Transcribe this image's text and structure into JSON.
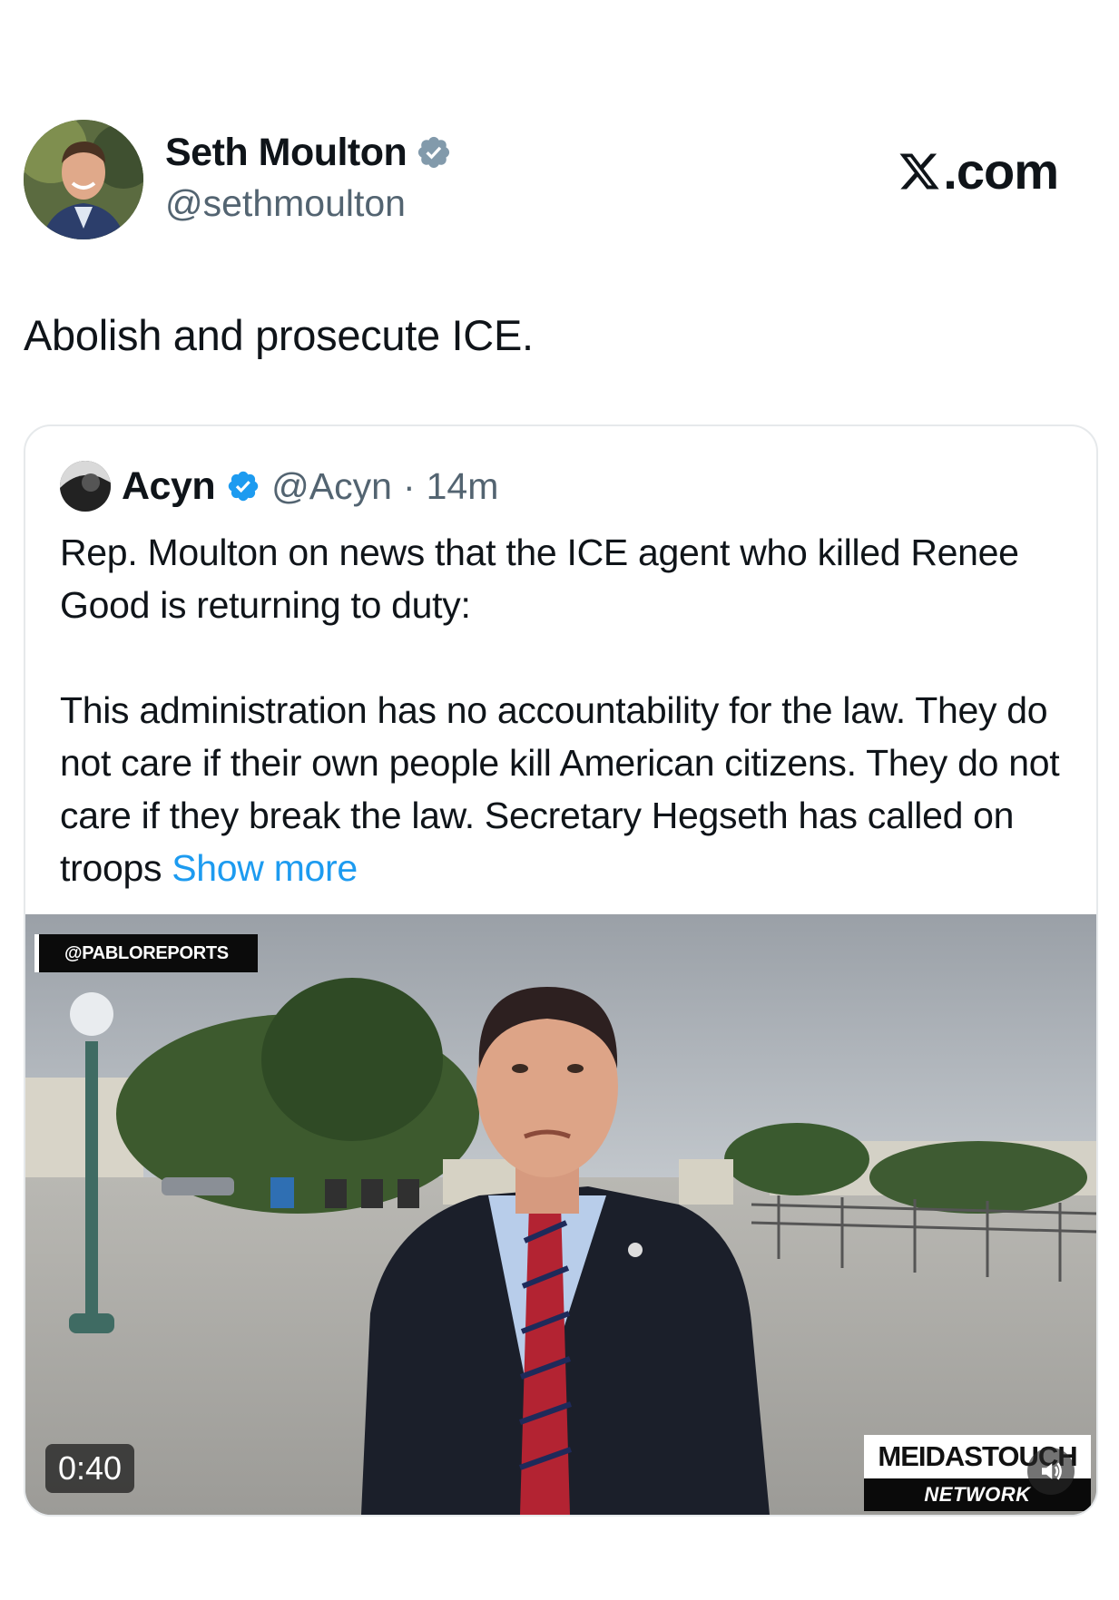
{
  "post": {
    "display_name": "Seth Moulton",
    "handle": "@sethmoulton",
    "site": ".com",
    "text": "Abolish and prosecute ICE."
  },
  "quote": {
    "display_name": "Acyn",
    "handle": "@Acyn",
    "separator": "·",
    "time": "14m",
    "paragraph_1": "Rep. Moulton on news that the ICE agent who killed Renee Good is returning to duty:",
    "paragraph_2": "This administration has no accountability for the law. They do not care if their own people kill American citizens. They do not care if they break the law. Secretary Hegseth has called on troops",
    "show_more": "Show more"
  },
  "video": {
    "source_tag": "@PABLOREPORTS",
    "duration": "0:40",
    "network_top": "MEIDASTOUCH",
    "network_bottom": "NETWORK"
  },
  "colors": {
    "link": "#1d9bf0",
    "verified": "#1d9bf0",
    "secondary_text": "#536471"
  },
  "icons": [
    "verified-badge-icon",
    "x-logo-icon",
    "speaker-icon"
  ]
}
